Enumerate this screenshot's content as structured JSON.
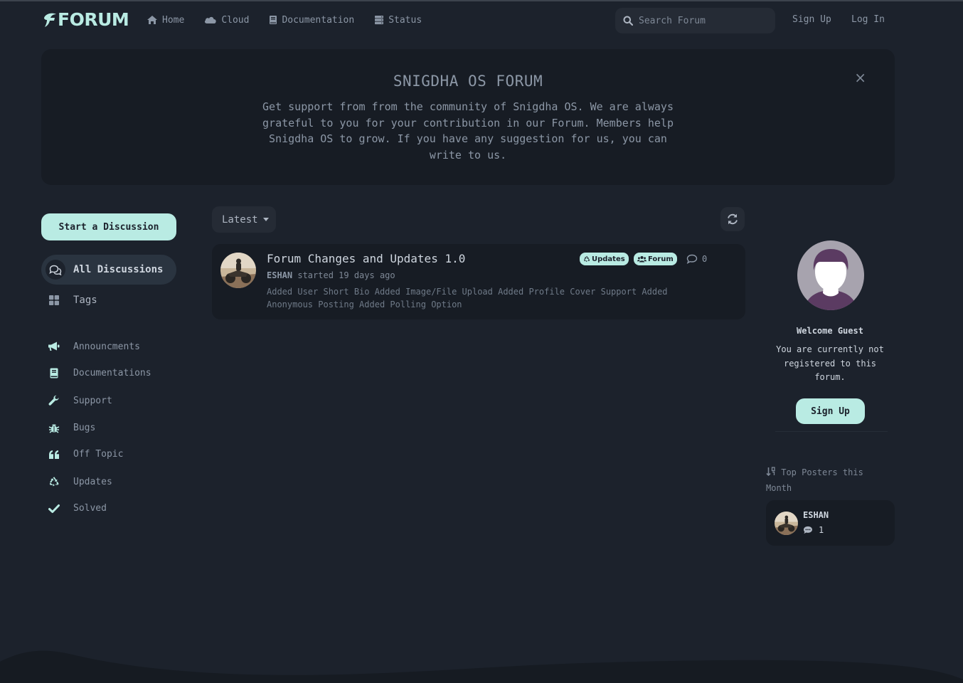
{
  "colors": {
    "accent": "#b9ebe3",
    "background": "#1c222c",
    "panel": "#171c24"
  },
  "header": {
    "logo_text": "FORUM",
    "nav": [
      {
        "label": "Home",
        "icon": "home-icon"
      },
      {
        "label": "Cloud",
        "icon": "cloud-icon"
      },
      {
        "label": "Documentation",
        "icon": "book-icon"
      },
      {
        "label": "Status",
        "icon": "server-icon"
      }
    ],
    "search_placeholder": "Search Forum",
    "sign_up": "Sign Up",
    "log_in": "Log In"
  },
  "hero": {
    "title": "SNIGDHA OS FORUM",
    "description": "Get support from from the community of Snigdha OS. We are always grateful to you for your contribution in our Forum. Members help Snigdha OS to grow. If you have any suggestion for us, you can write to us.",
    "close": "×"
  },
  "sidebar": {
    "start_discussion": "Start a Discussion",
    "all_discussions": "All Discussions",
    "tags": "Tags",
    "categories": [
      {
        "label": "Announcments",
        "icon": "bullhorn-icon"
      },
      {
        "label": "Documentations",
        "icon": "book-icon"
      },
      {
        "label": "Support",
        "icon": "wrench-icon"
      },
      {
        "label": "Bugs",
        "icon": "bug-icon"
      },
      {
        "label": "Off Topic",
        "icon": "quote-icon"
      },
      {
        "label": "Updates",
        "icon": "recycle-icon"
      },
      {
        "label": "Solved",
        "icon": "check-icon"
      }
    ]
  },
  "toolbar": {
    "sort_label": "Latest"
  },
  "discussions": [
    {
      "title": "Forum Changes and Updates 1.0",
      "author": "ESHAN",
      "meta": " started 19 days ago",
      "excerpt": "Added User Short Bio Added Image/File Upload Added Profile Cover Support Added Anonymous Posting Added Polling Option",
      "tags": [
        "Updates",
        "Forum"
      ],
      "replies": "0"
    }
  ],
  "welcome": {
    "title": "Welcome Guest",
    "text": "You are currently not registered to this forum.",
    "sign_up": "Sign Up"
  },
  "top_posters": {
    "title": "Top Posters this Month",
    "items": [
      {
        "name": "ESHAN",
        "count": "1"
      }
    ]
  }
}
